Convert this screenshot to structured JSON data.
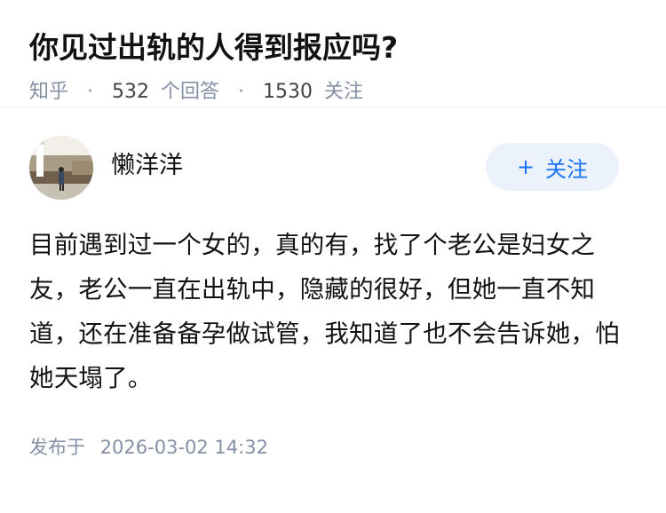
{
  "question": {
    "title": "你见过出轨的人得到报应吗?",
    "source": "知乎",
    "answer_count": "532",
    "answer_word": "个回答",
    "follower_count": "1530",
    "follower_word": "关注"
  },
  "answer": {
    "author_name": "懒洋洋",
    "follow_label": "关注",
    "follow_icon": "plus-icon",
    "content": "目前遇到过一个女的，真的有，找了个老公是妇女之友，老公一直在出轨中，隐藏的很好，但她一直不知道，还在准备备孕做试管，我知道了也不会告诉她，怕她天塌了。",
    "publish_label": "发布于",
    "publish_time": "2026-03-02 14:32"
  },
  "colors": {
    "meta_gray": "#8590a6",
    "follow_button_bg": "#ebf2fb",
    "follow_button_text": "#1772f6"
  }
}
